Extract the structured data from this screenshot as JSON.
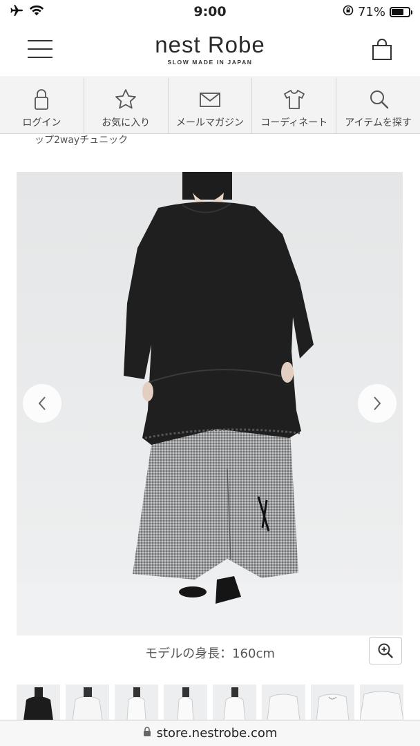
{
  "status_bar": {
    "time": "9:00",
    "battery_percent": "71%",
    "battery_level": 0.71,
    "icons": [
      "airplane-icon",
      "wifi-icon",
      "rotation-lock-icon",
      "battery-icon"
    ]
  },
  "header": {
    "brand_name": "nest Robe",
    "brand_tagline": "SLOW MADE IN JAPAN",
    "icons": [
      "menu-icon",
      "shopping-bag-icon"
    ]
  },
  "nav": {
    "items": [
      {
        "label": "ログイン",
        "icon": "lock-icon"
      },
      {
        "label": "お気に入り",
        "icon": "star-icon"
      },
      {
        "label": "メールマガジン",
        "icon": "envelope-icon"
      },
      {
        "label": "コーディネート",
        "icon": "tshirt-icon"
      },
      {
        "label": "アイテムを探す",
        "icon": "search-icon"
      }
    ]
  },
  "breadcrumb": {
    "text": "ップ2wayチュニック"
  },
  "product": {
    "model_height": "モデルの身長：160cm",
    "thumbnail_count": 8
  },
  "browser": {
    "url": "store.nestrobe.com"
  },
  "colors": {
    "nav_background": "#f3f3f3",
    "divider": "#d6d6d6",
    "photo_background": "#e9ebec"
  }
}
